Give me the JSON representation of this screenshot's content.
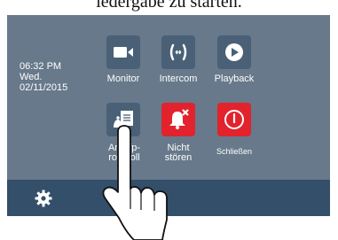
{
  "caption": "iedergabe zu starten.",
  "clock": {
    "time": "06:32 PM",
    "day": "Wed.",
    "date": "02/11/2015"
  },
  "tiles": {
    "monitor": {
      "label": "Monitor",
      "icon": "video-camera-icon"
    },
    "intercom": {
      "label": "Intercom",
      "icon": "intercom-icon"
    },
    "playback": {
      "label": "Playback",
      "icon": "play-icon"
    },
    "call_log": {
      "label_line1": "Anrufp-",
      "label_line2": "rotokoll",
      "icon": "call-log-icon"
    },
    "dnd": {
      "label_line1": "Nicht",
      "label_line2": "stören",
      "icon": "bell-muted-icon"
    },
    "shutdown": {
      "label": "Schließen",
      "icon": "power-icon"
    }
  },
  "settings": {
    "icon": "gear-icon"
  },
  "colors": {
    "screen_bg": "#67798a",
    "tile_bg": "#4a6076",
    "tile_red": "#e2232d",
    "bottom_bar": "#334f69"
  }
}
